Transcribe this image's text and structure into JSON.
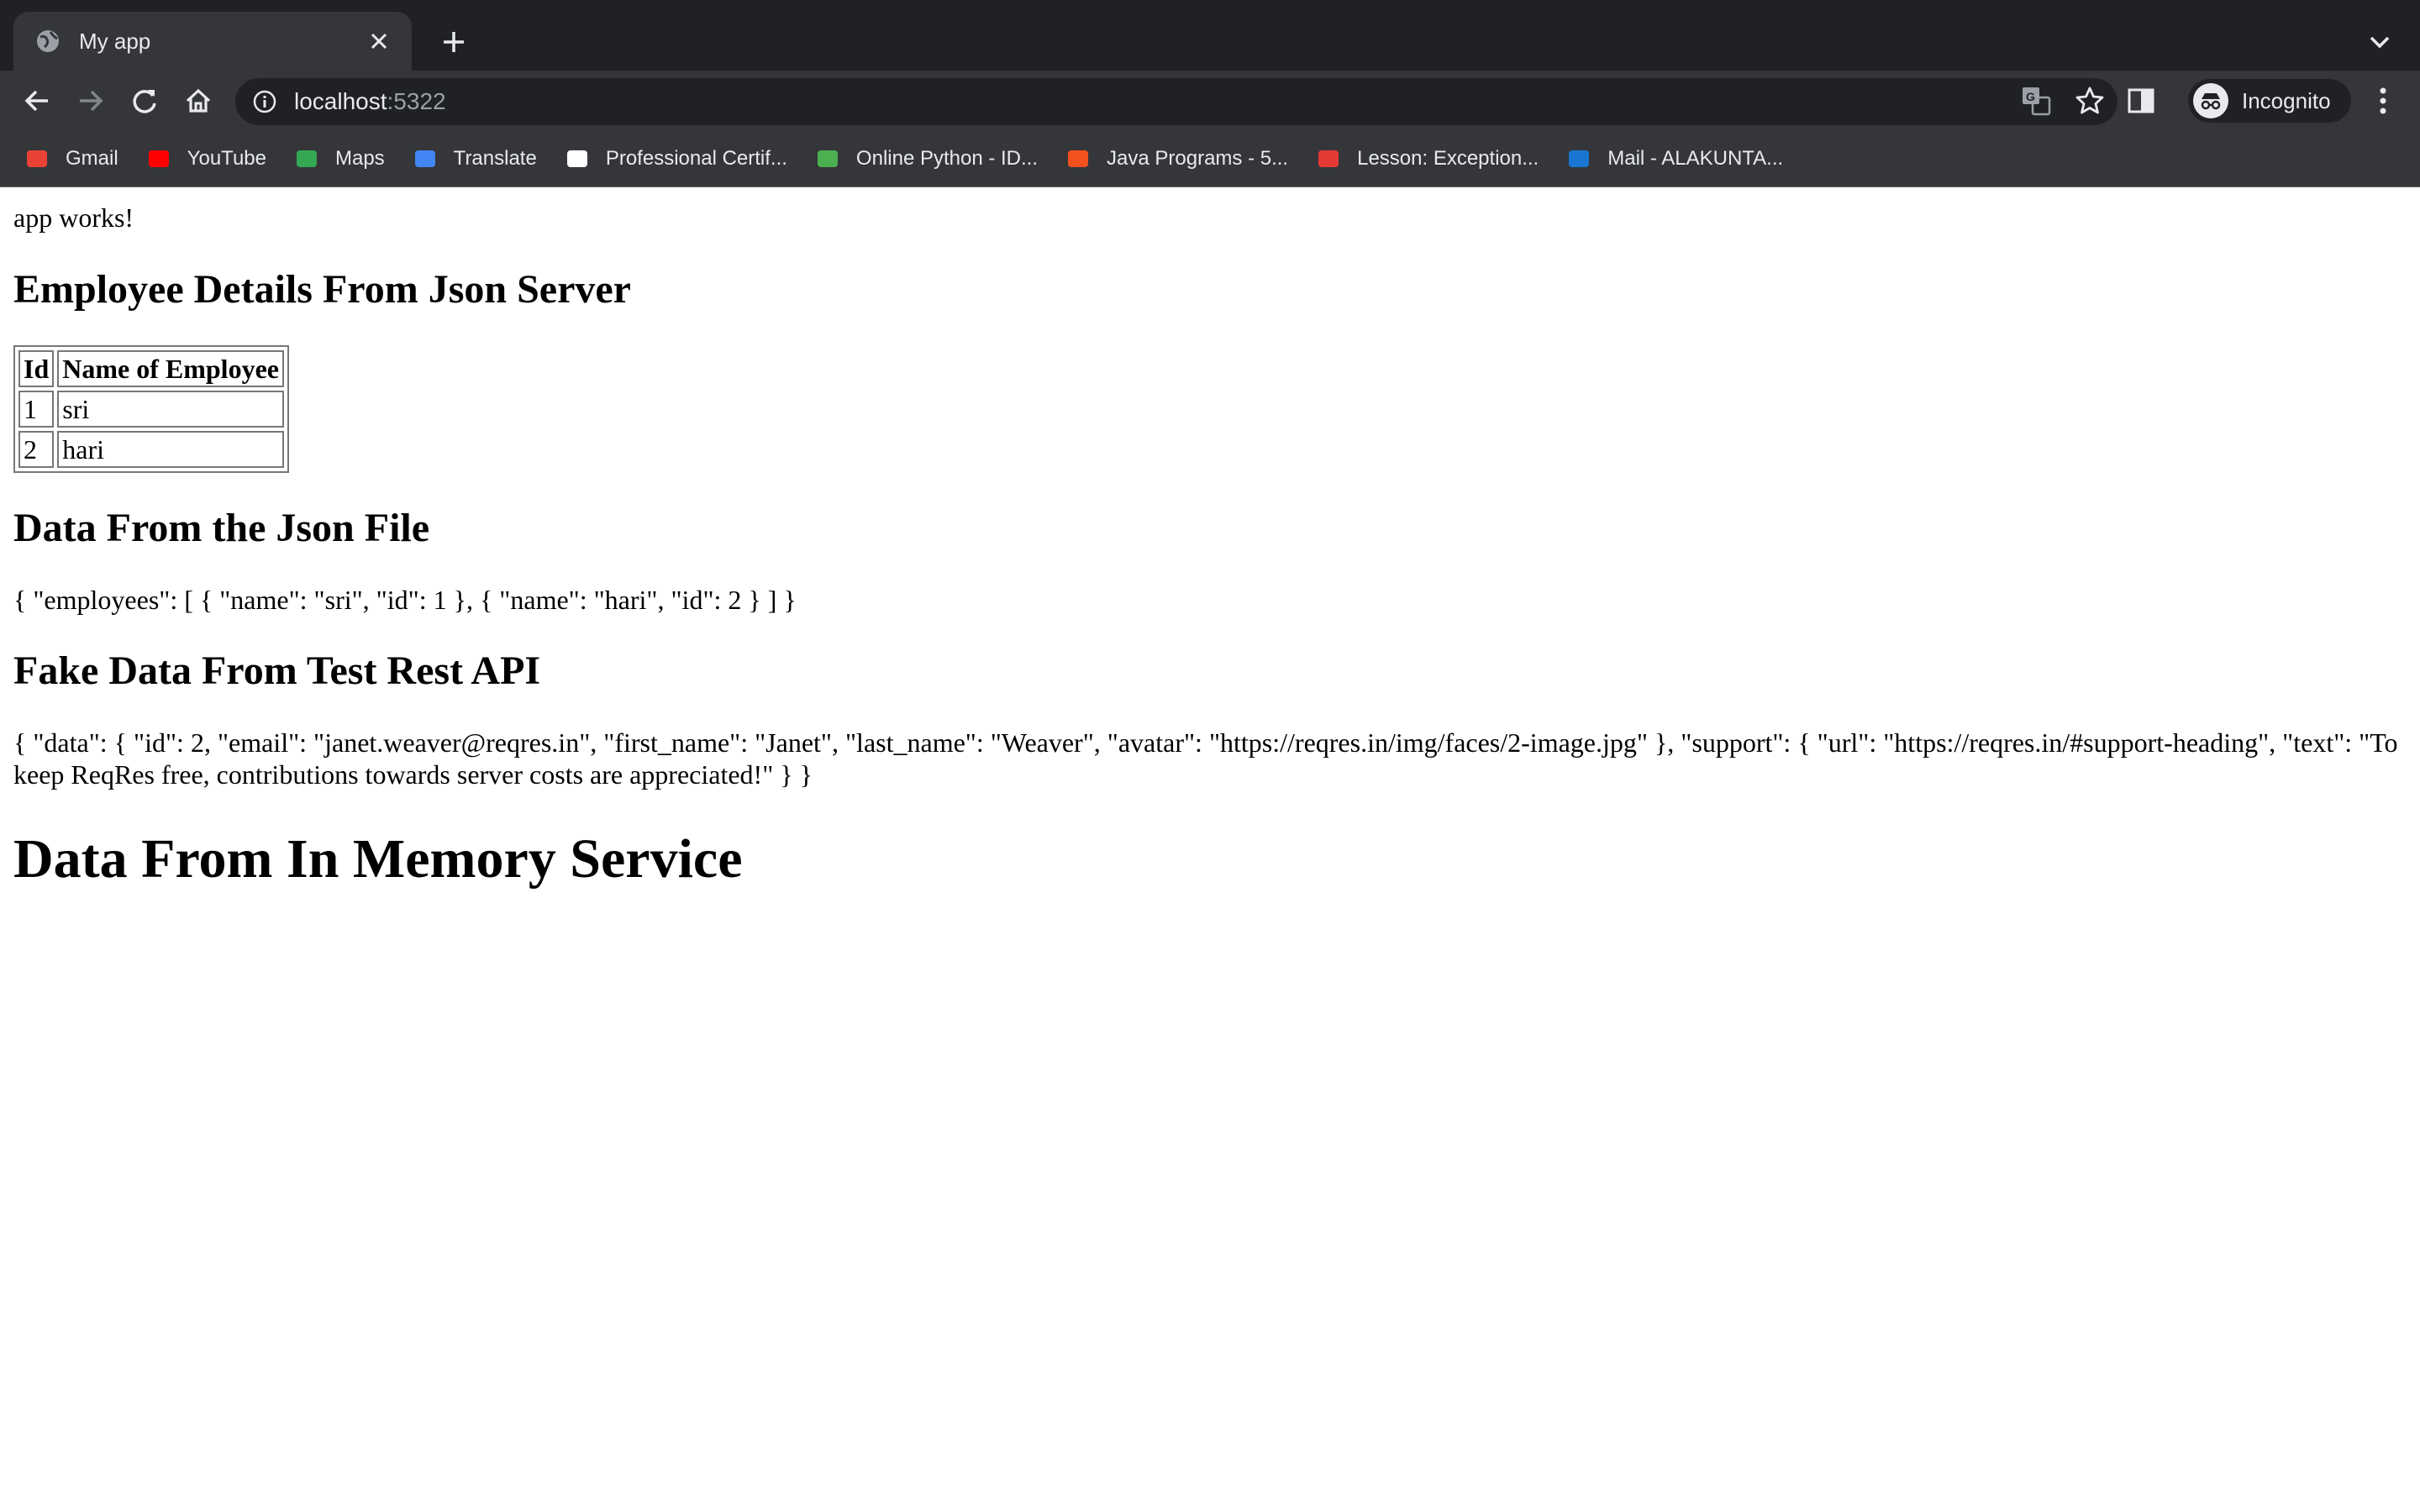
{
  "browser": {
    "tab_title": "My app",
    "url_host": "localhost",
    "url_port": ":5322",
    "profile_label": "Incognito",
    "bookmarks": [
      {
        "label": "Gmail",
        "icon": "gmail-icon",
        "color": "#ea4335"
      },
      {
        "label": "YouTube",
        "icon": "youtube-icon",
        "color": "#ff0000"
      },
      {
        "label": "Maps",
        "icon": "maps-icon",
        "color": "#34a853"
      },
      {
        "label": "Translate",
        "icon": "translate-icon",
        "color": "#4285f4"
      },
      {
        "label": "Professional Certif...",
        "icon": "google-icon",
        "color": "#ffffff"
      },
      {
        "label": "Online Python - ID...",
        "icon": "python-icon",
        "color": "#4caf50"
      },
      {
        "label": "Java Programs - 5...",
        "icon": "java-icon",
        "color": "#f4511e"
      },
      {
        "label": "Lesson: Exception...",
        "icon": "oracle-icon",
        "color": "#e53935"
      },
      {
        "label": "Mail - ALAKUNTA...",
        "icon": "outlook-icon",
        "color": "#1976d2"
      }
    ]
  },
  "page": {
    "intro": "app works!",
    "section1_title": "Employee Details From Json Server",
    "table": {
      "headers": [
        "Id",
        "Name of Employee"
      ],
      "rows": [
        [
          "1",
          "sri"
        ],
        [
          "2",
          "hari"
        ]
      ]
    },
    "section2_title": "Data From the Json File",
    "json_file_text": "{ \"employees\": [ { \"name\": \"sri\", \"id\": 1 }, { \"name\": \"hari\", \"id\": 2 } ] }",
    "section3_title": "Fake Data From Test Rest API",
    "api_text": "{ \"data\": { \"id\": 2, \"email\": \"janet.weaver@reqres.in\", \"first_name\": \"Janet\", \"last_name\": \"Weaver\", \"avatar\": \"https://reqres.in/img/faces/2-image.jpg\" }, \"support\": { \"url\": \"https://reqres.in/#support-heading\", \"text\": \"To keep ReqRes free, contributions towards server costs are appreciated!\" } }",
    "section4_title": "Data From In Memory Service"
  }
}
